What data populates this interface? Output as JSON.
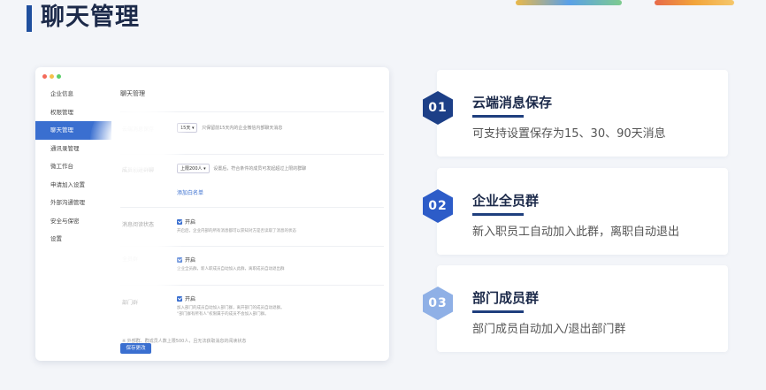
{
  "header": {
    "title": "聊天管理"
  },
  "colors": {
    "accent": "#3a6fd0",
    "navy": "#1f3f7e",
    "hex1": "#1c3f87",
    "hex2": "#2d5cc8",
    "hex3": "#8fb0e6"
  },
  "window": {
    "sidebar": {
      "items": [
        {
          "label": "企业信息"
        },
        {
          "label": "权限管理"
        },
        {
          "label": "聊天管理"
        },
        {
          "label": "通讯录管理"
        },
        {
          "label": "微工作台"
        },
        {
          "label": "申请加入设置"
        },
        {
          "label": "外部沟通管理"
        },
        {
          "label": "安全与保密"
        },
        {
          "label": "设置"
        }
      ],
      "active_index": 2
    },
    "main": {
      "title": "聊天管理",
      "cloud": {
        "label": "云端消息保存",
        "select": "15天 ▾",
        "desc": "只保留前15天内的企业微信内部聊天消息"
      },
      "member_group": {
        "label": "成员创建群聊",
        "select": "上限200人 ▾",
        "desc": "设置后，符合条件的成员可发起超过上限的群聊",
        "link": "添加白名单"
      },
      "read_status": {
        "label": "消息阅读状态",
        "on": "开启",
        "desc": "开启后，企业内部的所有消息都可以获知对方是否读取了消息的状态"
      },
      "all_group": {
        "label": "全员群",
        "on": "开启",
        "desc": "企业全员群，新人职成员自动加入此群，离职成员自动退出群"
      },
      "dept_group": {
        "label": "部门群",
        "on": "开启",
        "desc1": "加入部门的成员自动加入部门群，离开部门的成员自动退群。",
        "desc2": "“部门群有所有人”权限属于的成员不会加入部门群。"
      },
      "note": "※ 外部群、群成员人数上限500人，且无法获取消息的阅读状态",
      "save": "保存更改"
    }
  },
  "features": [
    {
      "num": "01",
      "title": "云端消息保存",
      "desc": "可支持设置保存为15、30、90天消息"
    },
    {
      "num": "02",
      "title": "企业全员群",
      "desc": "新入职员工自动加入此群，离职自动退出"
    },
    {
      "num": "03",
      "title": "部门成员群",
      "desc": "部门成员自动加入/退出部门群"
    }
  ]
}
